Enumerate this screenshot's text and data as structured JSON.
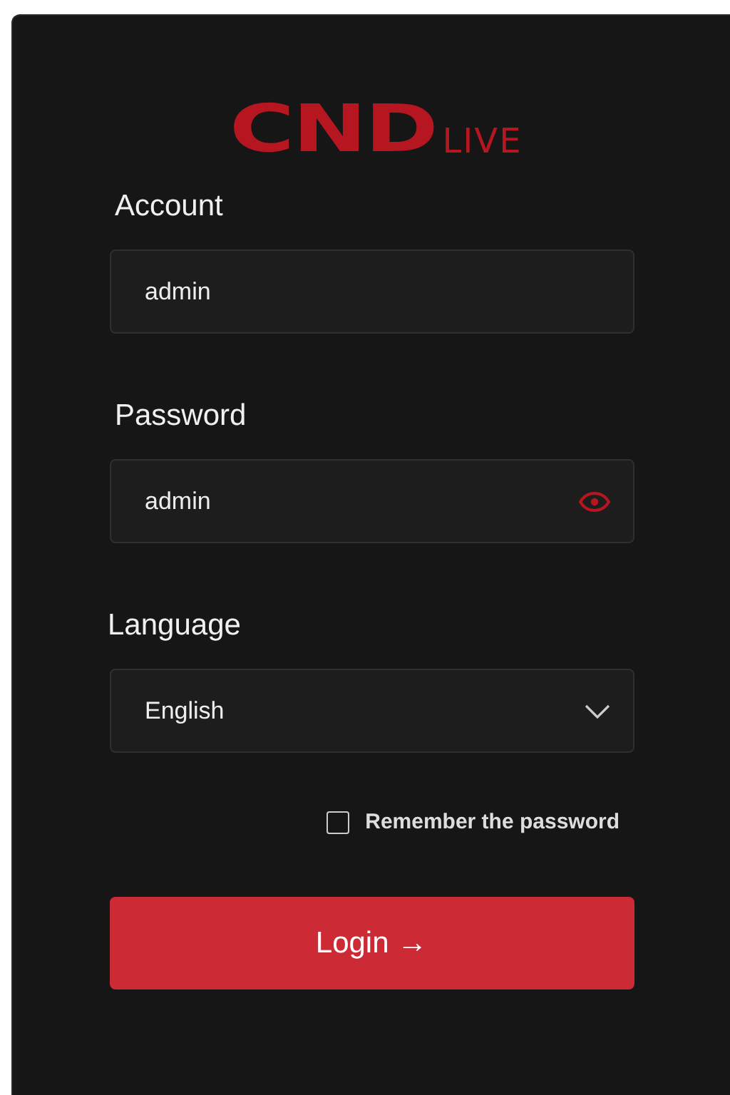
{
  "logo": {
    "mark": "CND",
    "suffix": "LIVE"
  },
  "fields": [
    {
      "kind": "text",
      "label": "Account",
      "value": "admin"
    },
    {
      "kind": "password",
      "label": "Password",
      "value": "admin",
      "masked": false
    },
    {
      "kind": "select",
      "label": "Language",
      "value": "English"
    }
  ],
  "remember": {
    "label": "Remember the password",
    "checked": false
  },
  "login": {
    "label": "Login →"
  }
}
